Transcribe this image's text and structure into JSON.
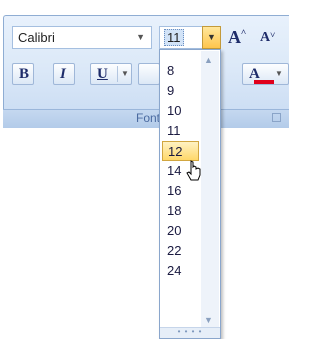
{
  "ribbon": {
    "font_name": "Calibri",
    "font_size": "11",
    "grow_font_label": "A",
    "shrink_font_label": "A",
    "bold_label": "B",
    "italic_label": "I",
    "underline_label": "U",
    "font_color_label": "A",
    "group_label": "Font"
  },
  "size_list": {
    "items": [
      "8",
      "9",
      "10",
      "11",
      "12",
      "14",
      "16",
      "18",
      "20",
      "22",
      "24"
    ],
    "selected": "12"
  },
  "colors": {
    "accent_highlight": "#ffd86a",
    "font_color_bar": "#e0001b",
    "ribbon_bg": "#dce9f8"
  }
}
